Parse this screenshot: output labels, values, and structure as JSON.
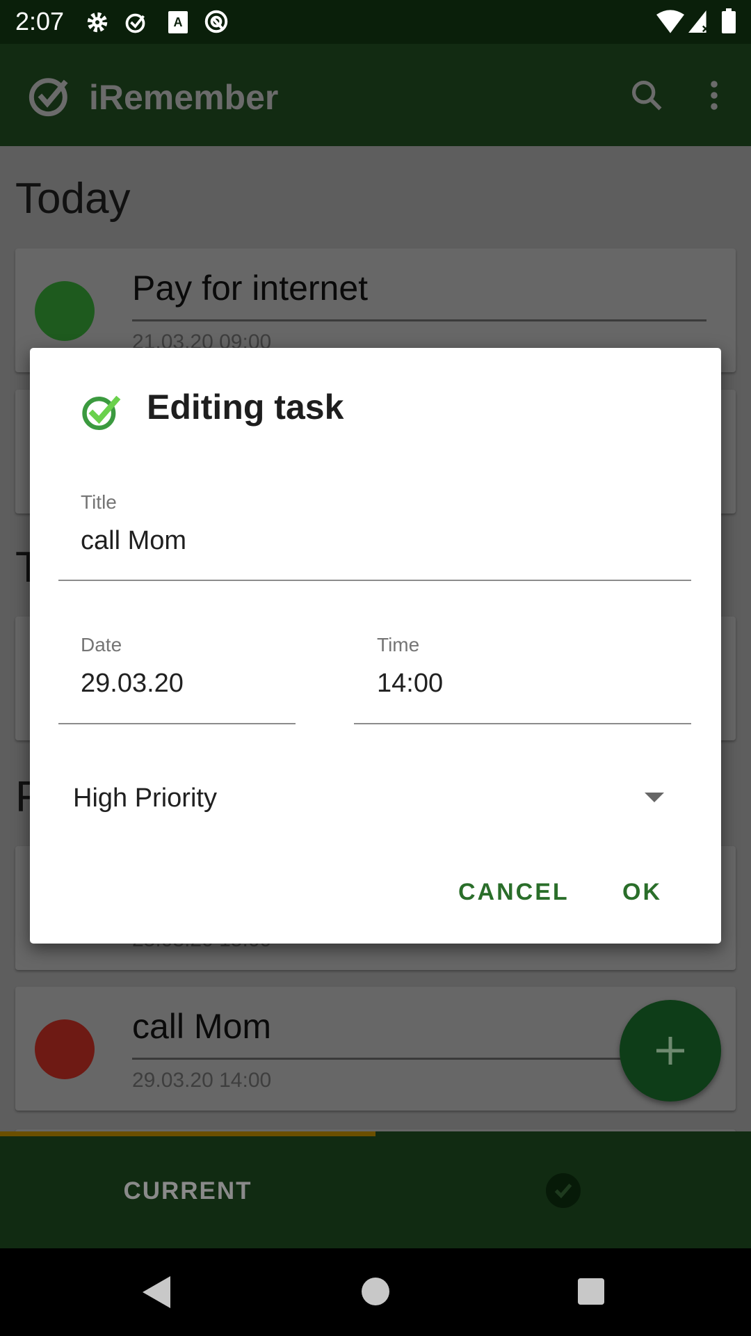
{
  "status_bar": {
    "time": "2:07",
    "icons": [
      "settings-icon",
      "check-circle-icon",
      "font-icon",
      "nfc-icon",
      "wifi-icon",
      "signal-icon",
      "battery-icon"
    ]
  },
  "app_bar": {
    "title": "iRemember",
    "icons": [
      "logo-check-icon",
      "search-icon",
      "more-vert-icon"
    ]
  },
  "sections": [
    {
      "header": "Today",
      "tasks": [
        {
          "title": "Pay for internet",
          "date": "21.03.20 09:00",
          "priority_color": "#1e5a1e"
        },
        {
          "title": "",
          "date": ""
        }
      ]
    },
    {
      "header": "T",
      "tasks": [
        {
          "title": "",
          "date": ""
        }
      ]
    },
    {
      "header": "F",
      "tasks": [
        {
          "title": "",
          "date": "25.03.20 15:00"
        },
        {
          "title": "call Mom",
          "date": "29.03.20 14:00",
          "priority_color": "#6e1a14"
        }
      ]
    }
  ],
  "fab": {
    "icon": "plus-icon"
  },
  "tabs": {
    "current": "CURRENT",
    "done_icon": "check-circle-icon",
    "indicator_color": "#6b4f00"
  },
  "dialog": {
    "title": "Editing task",
    "fields": {
      "title_label": "Title",
      "title_value": "call Mom",
      "date_label": "Date",
      "date_value": "29.03.20",
      "time_label": "Time",
      "time_value": "14:00"
    },
    "priority": "High Priority",
    "cancel": "CANCEL",
    "ok": "OK",
    "accent": "#2a6e2a"
  }
}
